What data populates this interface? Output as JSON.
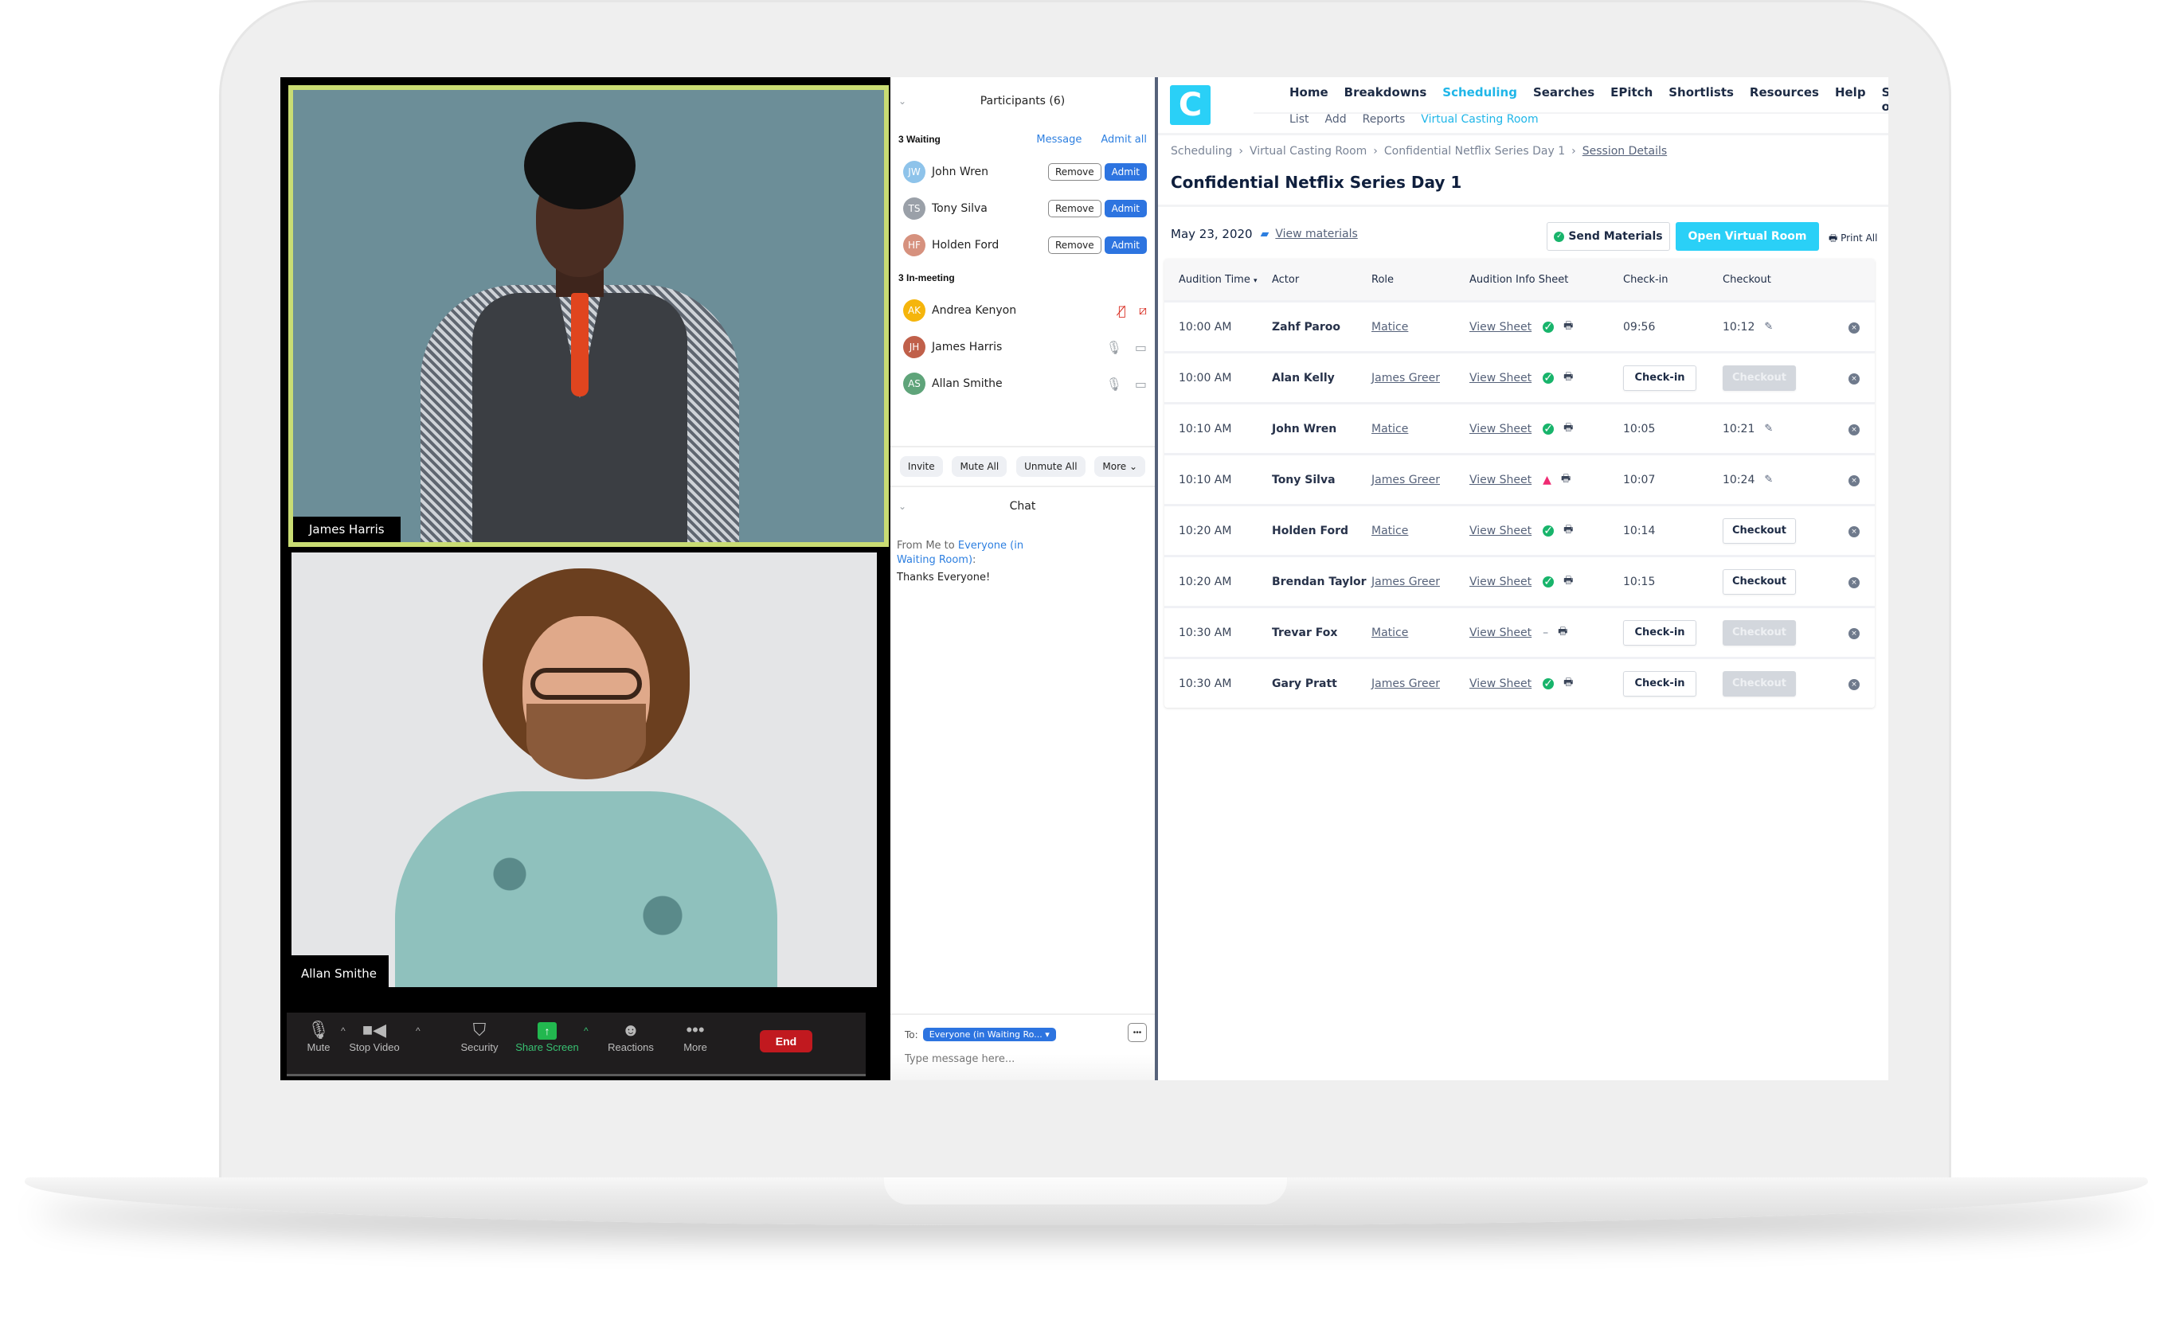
{
  "video": {
    "tiles": [
      {
        "name": "James Harris"
      },
      {
        "name": "Allan Smithe"
      }
    ],
    "toolbar": {
      "mute": "Mute",
      "stop_video": "Stop Video",
      "security": "Security",
      "share_screen": "Share Screen",
      "reactions": "Reactions",
      "more": "More",
      "end": "End"
    }
  },
  "participants": {
    "title": "Participants (6)",
    "waiting_label": "3 Waiting",
    "message_link": "Message",
    "admit_all_link": "Admit all",
    "remove_label": "Remove",
    "admit_label": "Admit",
    "waiting": [
      {
        "initials": "JW",
        "name": "John Wren",
        "color": "#8ec3ea"
      },
      {
        "initials": "TS",
        "name": "Tony Silva",
        "color": "#9aa0a8"
      },
      {
        "initials": "HF",
        "name": "Holden Ford",
        "color": "#d6917e"
      }
    ],
    "in_meeting_label": "3 In-meeting",
    "in_meeting": [
      {
        "initials": "AK",
        "name": "Andrea Kenyon",
        "color": "#f5b50c",
        "muted": true,
        "video_off": true
      },
      {
        "initials": "JH",
        "name": "James Harris",
        "color": "#c0604a",
        "muted": false,
        "video_off": false
      },
      {
        "initials": "AS",
        "name": "Allan Smithe",
        "color": "#5fa47a",
        "muted": false,
        "video_off": false
      }
    ],
    "actions": {
      "invite": "Invite",
      "mute_all": "Mute All",
      "unmute_all": "Unmute All",
      "more": "More"
    }
  },
  "chat": {
    "title": "Chat",
    "message": {
      "from": "From Me to",
      "to": "Everyone (in Waiting Room)",
      "suffix": ":",
      "text": "Thanks Everyone!"
    },
    "to_label": "To:",
    "to_value": "Everyone (in Waiting Ro...",
    "placeholder": "Type message here..."
  },
  "app": {
    "logo_letter": "C",
    "nav": [
      "Home",
      "Breakdowns",
      "Scheduling",
      "Searches",
      "EPitch",
      "Shortlists",
      "Resources",
      "Help",
      "Sign off"
    ],
    "nav_active": "Scheduling",
    "subnav": [
      "List",
      "Add",
      "Reports",
      "Virtual Casting Room"
    ],
    "subnav_active": "Virtual Casting Room",
    "breadcrumb": [
      "Scheduling",
      "Virtual Casting Room",
      "Confidential Netflix Series Day 1",
      "Session Details"
    ],
    "title": "Confidential Netflix Series Day 1",
    "date": "May 23, 2020",
    "view_materials": "View materials",
    "send_materials": "Send Materials",
    "open_room": "Open Virtual Room",
    "print_all": "Print All",
    "table": {
      "headers": [
        "Audition Time",
        "Actor",
        "Role",
        "Audition Info Sheet",
        "Check-in",
        "Checkout"
      ],
      "sheet_label": "View Sheet",
      "checkin_label": "Check-in",
      "checkout_label": "Checkout",
      "rows": [
        {
          "time": "10:00 AM",
          "actor": "Zahf Paroo",
          "role": "Matice",
          "status": "ok",
          "checkin": "09:56",
          "checkout": "10:12",
          "checkout_state": "done"
        },
        {
          "time": "10:00 AM",
          "actor": "Alan Kelly",
          "role": "James Greer",
          "status": "ok",
          "checkin": null,
          "checkout": null,
          "checkout_state": "disabled"
        },
        {
          "time": "10:10 AM",
          "actor": "John Wren",
          "role": "Matice",
          "status": "ok",
          "checkin": "10:05",
          "checkout": "10:21",
          "checkout_state": "done"
        },
        {
          "time": "10:10 AM",
          "actor": "Tony Silva",
          "role": "James Greer",
          "status": "warning",
          "checkin": "10:07",
          "checkout": "10:24",
          "checkout_state": "done"
        },
        {
          "time": "10:20 AM",
          "actor": "Holden Ford",
          "role": "Matice",
          "status": "ok",
          "checkin": "10:14",
          "checkout": null,
          "checkout_state": "enabled"
        },
        {
          "time": "10:20 AM",
          "actor": "Brendan Taylor",
          "role": "James Greer",
          "status": "ok",
          "checkin": "10:15",
          "checkout": null,
          "checkout_state": "enabled"
        },
        {
          "time": "10:30 AM",
          "actor": "Trevar Fox",
          "role": "Matice",
          "status": "none",
          "checkin": null,
          "checkout": null,
          "checkout_state": "disabled"
        },
        {
          "time": "10:30 AM",
          "actor": "Gary Pratt",
          "role": "James Greer",
          "status": "ok",
          "checkin": null,
          "checkout": null,
          "checkout_state": "disabled"
        }
      ]
    }
  },
  "colors": {
    "accent_cyan": "#2ad0f7",
    "zoom_blue": "#2d74e0",
    "active_speaker": "#c9dc73",
    "end_red": "#c1191f",
    "ok_green": "#18b46b",
    "warn_pink": "#ef2a72"
  }
}
